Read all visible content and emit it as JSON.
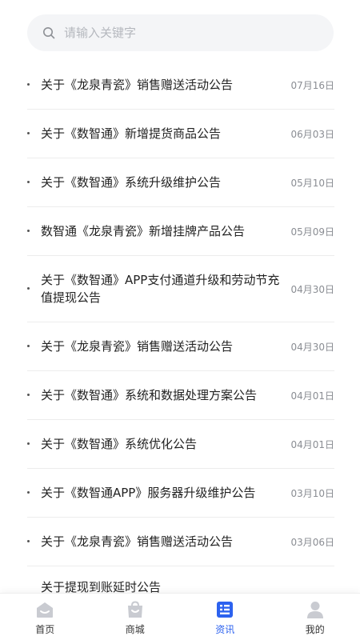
{
  "search": {
    "placeholder": "请输入关键字"
  },
  "news": [
    {
      "title": "关于《龙泉青瓷》销售赠送活动公告",
      "date": "07月16日"
    },
    {
      "title": "关于《数智通》新增提货商品公告",
      "date": "06月03日"
    },
    {
      "title": "关于《数智通》系统升级维护公告",
      "date": "05月10日"
    },
    {
      "title": "数智通《龙泉青瓷》新增挂牌产品公告",
      "date": "05月09日"
    },
    {
      "title": "关于《数智通》APP支付通道升级和劳动节充值提现公告",
      "date": "04月30日"
    },
    {
      "title": "关于《龙泉青瓷》销售赠送活动公告",
      "date": "04月30日"
    },
    {
      "title": "关于《数智通》系统和数据处理方案公告",
      "date": "04月01日"
    },
    {
      "title": "关于《数智通》系统优化公告",
      "date": "04月01日"
    },
    {
      "title": "关于《数智通APP》服务器升级维护公告",
      "date": "03月10日"
    },
    {
      "title": "关于《龙泉青瓷》销售赠送活动公告",
      "date": "03月06日"
    },
    {
      "title": "关于提现到账延时公告",
      "date": ""
    }
  ],
  "tabbar": {
    "items": [
      {
        "label": "首页",
        "icon": "home-icon"
      },
      {
        "label": "商城",
        "icon": "shopping-bag-icon"
      },
      {
        "label": "资讯",
        "icon": "news-icon"
      },
      {
        "label": "我的",
        "icon": "user-icon"
      }
    ],
    "active_index": 2
  },
  "colors": {
    "accent": "#2c62ef",
    "inactive_icon": "#c9cbd1"
  }
}
